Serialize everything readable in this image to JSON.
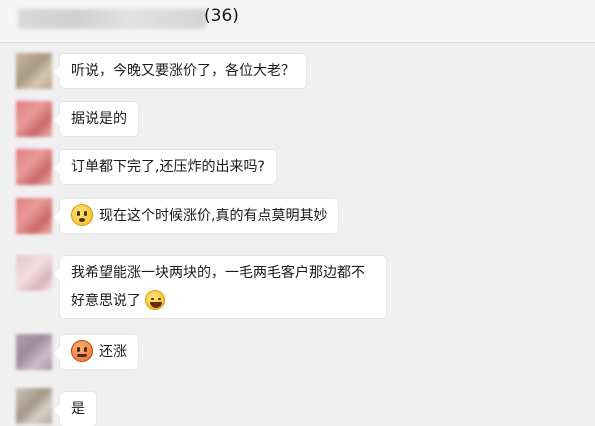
{
  "header": {
    "member_count": "(36)"
  },
  "messages": [
    {
      "text": "听说，今晚又要涨价了，各位大老？"
    },
    {
      "text": "据说是的"
    },
    {
      "text": "订单都下完了,还压炸的出来吗?"
    },
    {
      "emoji": "flushed-emoji-icon",
      "text": "现在这个时候涨价,真的有点莫明其妙"
    },
    {
      "text": "我希望能涨一块两块的，一毛两毛客户那边都不好意思说了",
      "emoji_after": "laughing-emoji-icon"
    },
    {
      "emoji": "angry-emoji-icon",
      "text": "还涨"
    },
    {
      "text": "是"
    }
  ]
}
